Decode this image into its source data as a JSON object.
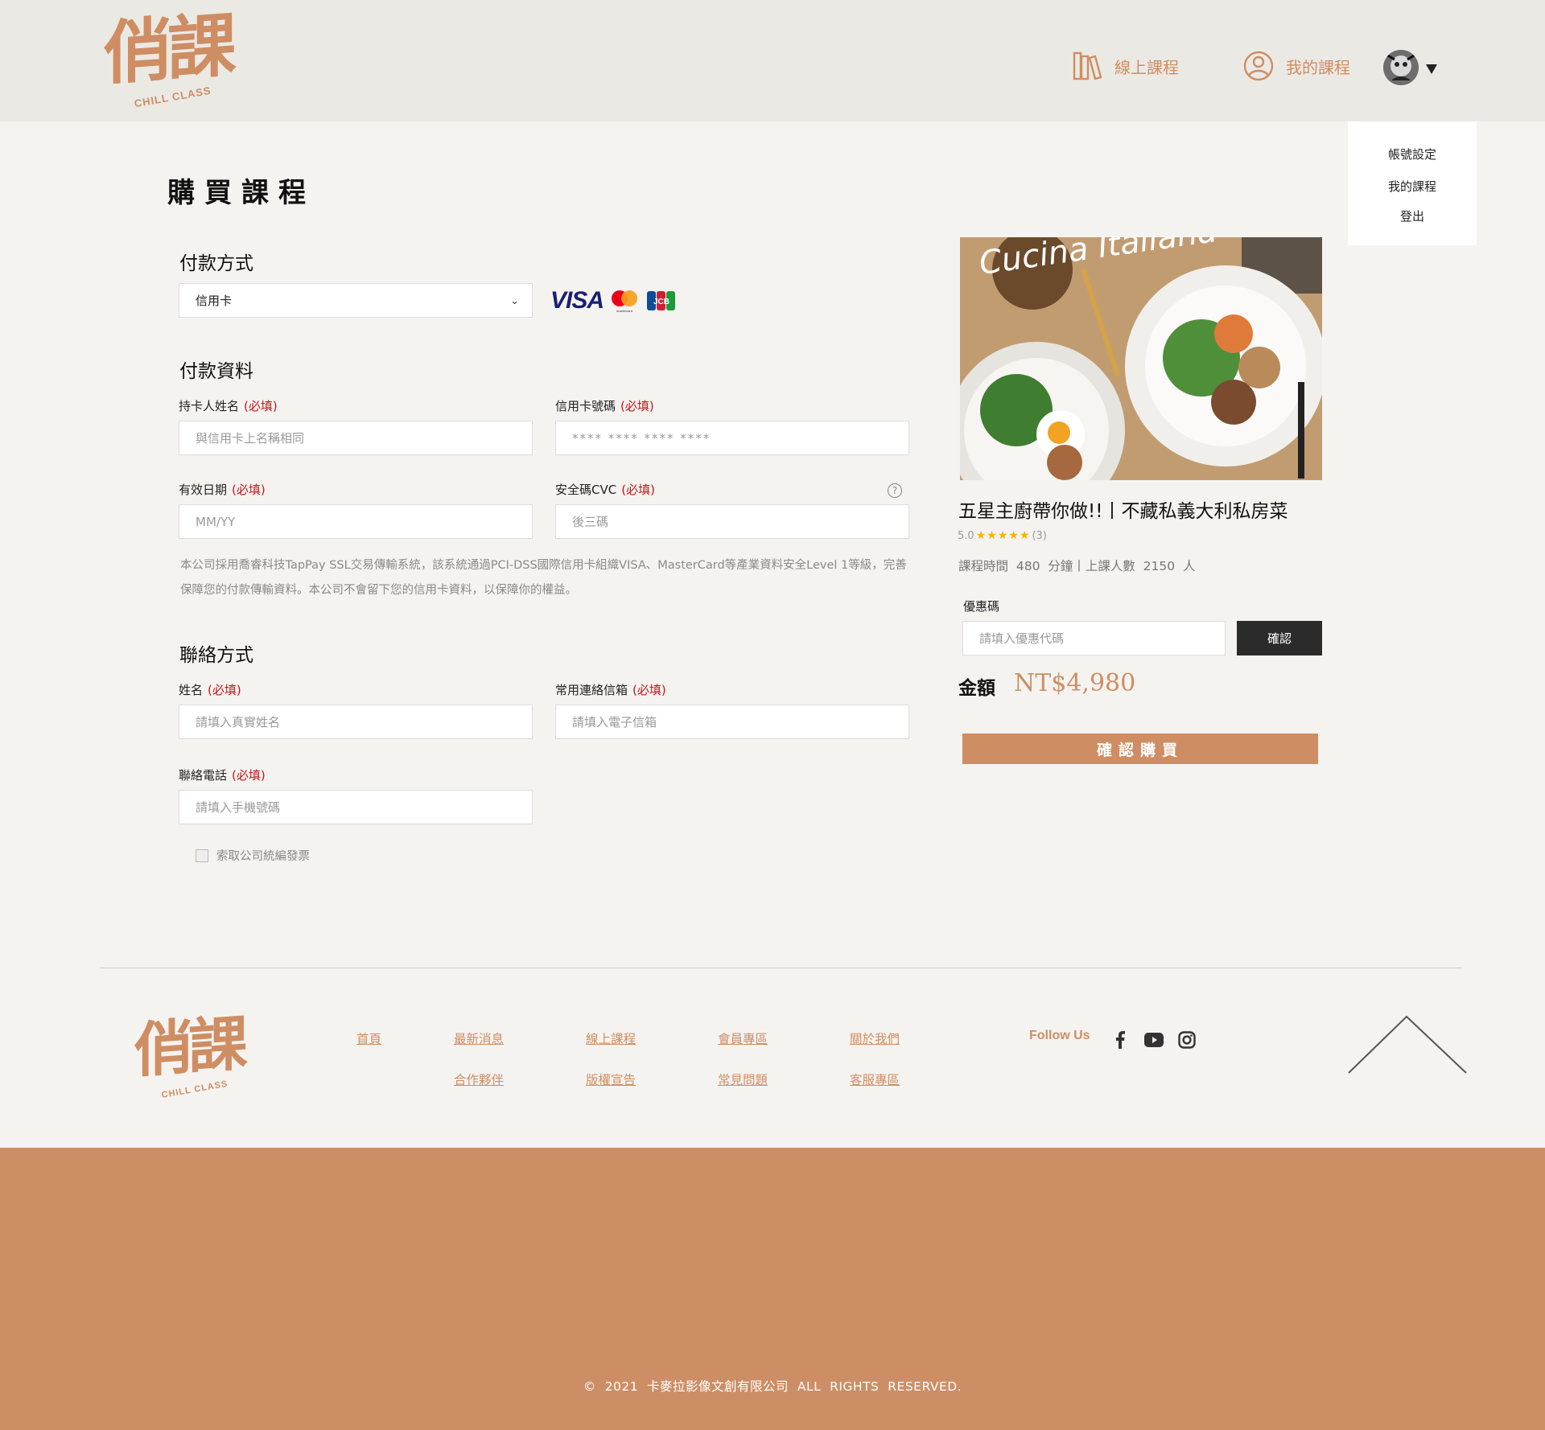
{
  "brand": {
    "logo_text": "俏課",
    "logo_sub": "CHILL CLASS",
    "color": "#cf8d63"
  },
  "header": {
    "nav": [
      {
        "label": "線上課程",
        "icon": "books-icon"
      },
      {
        "label": "我的課程",
        "icon": "user-circle-icon"
      }
    ],
    "dropdown": [
      "帳號設定",
      "我的課程",
      "登出"
    ]
  },
  "page": {
    "title": "購買課程"
  },
  "payment_method": {
    "title": "付款方式",
    "selected": "信用卡",
    "card_brands": [
      "VISA",
      "mastercard",
      "JCB"
    ]
  },
  "payment_info": {
    "title": "付款資料",
    "required_tag": "(必填)",
    "cardholder": {
      "label": "持卡人姓名",
      "placeholder": "與信用卡上名稱相同"
    },
    "card_number": {
      "label": "信用卡號碼",
      "placeholder": "**** **** **** ****"
    },
    "expiry": {
      "label": "有效日期",
      "placeholder": "MM/YY"
    },
    "cvc": {
      "label": "安全碼CVC",
      "placeholder": "後三碼",
      "help": "?"
    },
    "notice": "本公司採用喬睿科技TapPay SSL交易傳輸系統，該系統通過PCI-DSS國際信用卡組織VISA、MasterCard等產業資料安全Level 1等級，完善保障您的付款傳輸資料。本公司不會留下您的信用卡資料，以保障你的權益。"
  },
  "contact": {
    "title": "聯絡方式",
    "name": {
      "label": "姓名",
      "placeholder": "請填入真實姓名"
    },
    "email": {
      "label": "常用連絡信箱",
      "placeholder": "請填入電子信箱"
    },
    "phone": {
      "label": "聯絡電話",
      "placeholder": "請填入手機號碼"
    },
    "invoice_checkbox": "索取公司統編發票"
  },
  "course": {
    "image_text": "Cucina Italiana",
    "title": "五星主廚帶你做!!丨不藏私義大利私房菜",
    "rating": "5.0",
    "stars": "★★★★★",
    "reviews": "(3)",
    "meta": "課程時間  480  分鐘丨上課人數  2150  人",
    "coupon_label": "優惠碼",
    "coupon_placeholder": "請填入優惠代碼",
    "coupon_button": "確認",
    "amount_label": "金額",
    "amount": "NT$4,980",
    "buy_button": "確認購買"
  },
  "footer": {
    "links_row1": [
      "首頁",
      "最新消息",
      "線上課程",
      "會員專區",
      "關於我們"
    ],
    "links_row2": [
      "合作夥伴",
      "版權宣告",
      "常見問題",
      "客服專區"
    ],
    "follow": "Follow Us",
    "social": [
      "facebook-icon",
      "youtube-icon",
      "instagram-icon"
    ],
    "copyright": "©  2021  卡麥拉影像文創有限公司  ALL  RIGHTS  RESERVED."
  }
}
